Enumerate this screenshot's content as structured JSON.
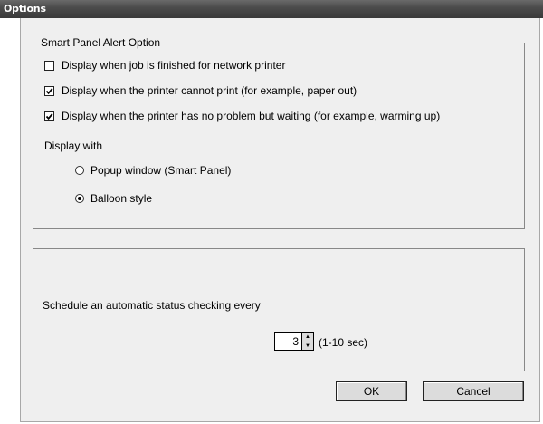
{
  "window": {
    "title": "Options"
  },
  "alert_group": {
    "legend": "Smart Panel Alert Option",
    "options": [
      {
        "label": "Display when job is finished for network printer",
        "checked": false
      },
      {
        "label": "Display when the printer cannot print (for example, paper out)",
        "checked": true
      },
      {
        "label": "Display when the printer has no problem but waiting (for example, warming up)",
        "checked": true
      }
    ],
    "display_with_label": "Display with",
    "radio_options": [
      {
        "label": "Popup window (Smart Panel)",
        "selected": false
      },
      {
        "label": "Balloon style",
        "selected": true
      }
    ]
  },
  "schedule": {
    "label": "Schedule an automatic status checking every",
    "value": "3",
    "range_hint": "(1-10 sec)",
    "up_icon": "spin-up-icon",
    "down_icon": "spin-down-icon"
  },
  "buttons": {
    "ok_label": "OK",
    "cancel_label": "Cancel"
  }
}
